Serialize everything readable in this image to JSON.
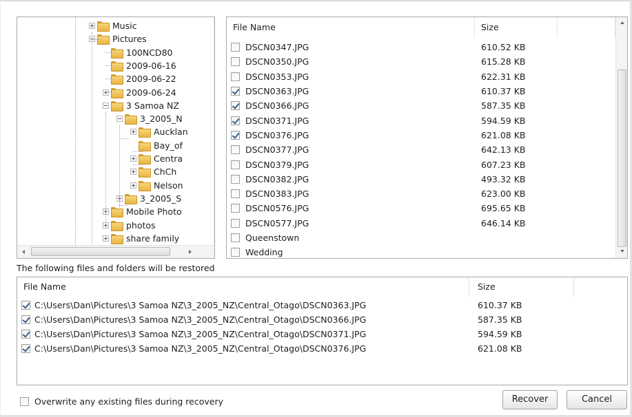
{
  "tree": {
    "items": [
      {
        "label": "Music",
        "expander": "plus"
      },
      {
        "label": "Pictures",
        "expander": "minus"
      },
      {
        "label": "100NCD80",
        "expander": "none"
      },
      {
        "label": "2009-06-16",
        "expander": "none"
      },
      {
        "label": "2009-06-22",
        "expander": "none"
      },
      {
        "label": "2009-06-24",
        "expander": "plus"
      },
      {
        "label": "3 Samoa NZ",
        "expander": "minus"
      },
      {
        "label": "3_2005_N",
        "expander": "minus"
      },
      {
        "label": "Aucklan",
        "expander": "plus"
      },
      {
        "label": "Bay_of",
        "expander": "none"
      },
      {
        "label": "Centra",
        "expander": "plus"
      },
      {
        "label": "ChCh",
        "expander": "plus"
      },
      {
        "label": "Nelson",
        "expander": "plus"
      },
      {
        "label": "3_2005_S",
        "expander": "plus"
      },
      {
        "label": "Mobile Photo",
        "expander": "plus"
      },
      {
        "label": "photos",
        "expander": "plus"
      },
      {
        "label": "share family",
        "expander": "plus"
      }
    ]
  },
  "files": {
    "headers": {
      "name": "File Name",
      "size": "Size"
    },
    "rows": [
      {
        "name": "DSCN0347.JPG",
        "size": "610.52 KB",
        "checked": false
      },
      {
        "name": "DSCN0350.JPG",
        "size": "615.28 KB",
        "checked": false
      },
      {
        "name": "DSCN0353.JPG",
        "size": "622.31 KB",
        "checked": false
      },
      {
        "name": "DSCN0363.JPG",
        "size": "610.37 KB",
        "checked": true
      },
      {
        "name": "DSCN0366.JPG",
        "size": "587.35 KB",
        "checked": true
      },
      {
        "name": "DSCN0371.JPG",
        "size": "594.59 KB",
        "checked": true
      },
      {
        "name": "DSCN0376.JPG",
        "size": "621.08 KB",
        "checked": true
      },
      {
        "name": "DSCN0377.JPG",
        "size": "642.13 KB",
        "checked": false
      },
      {
        "name": "DSCN0379.JPG",
        "size": "607.23 KB",
        "checked": false
      },
      {
        "name": "DSCN0382.JPG",
        "size": "493.32 KB",
        "checked": false
      },
      {
        "name": "DSCN0383.JPG",
        "size": "623.00 KB",
        "checked": false
      },
      {
        "name": "DSCN0576.JPG",
        "size": "695.65 KB",
        "checked": false
      },
      {
        "name": "DSCN0577.JPG",
        "size": "646.14 KB",
        "checked": false
      },
      {
        "name": "Queenstown",
        "size": "",
        "checked": false
      },
      {
        "name": "Wedding",
        "size": "",
        "checked": false
      }
    ]
  },
  "restore": {
    "caption": "The following files and folders will be restored",
    "headers": {
      "name": "File Name",
      "size": "Size"
    },
    "rows": [
      {
        "path": "C:\\Users\\Dan\\Pictures\\3 Samoa NZ\\3_2005_NZ\\Central_Otago\\DSCN0363.JPG",
        "size": "610.37 KB",
        "checked": true
      },
      {
        "path": "C:\\Users\\Dan\\Pictures\\3 Samoa NZ\\3_2005_NZ\\Central_Otago\\DSCN0366.JPG",
        "size": "587.35 KB",
        "checked": true
      },
      {
        "path": "C:\\Users\\Dan\\Pictures\\3 Samoa NZ\\3_2005_NZ\\Central_Otago\\DSCN0371.JPG",
        "size": "594.59 KB",
        "checked": true
      },
      {
        "path": "C:\\Users\\Dan\\Pictures\\3 Samoa NZ\\3_2005_NZ\\Central_Otago\\DSCN0376.JPG",
        "size": "621.08 KB",
        "checked": true
      }
    ]
  },
  "options": {
    "overwrite_label": "Overwrite any existing files during recovery",
    "overwrite_checked": false
  },
  "buttons": {
    "recover": "Recover",
    "cancel": "Cancel"
  }
}
